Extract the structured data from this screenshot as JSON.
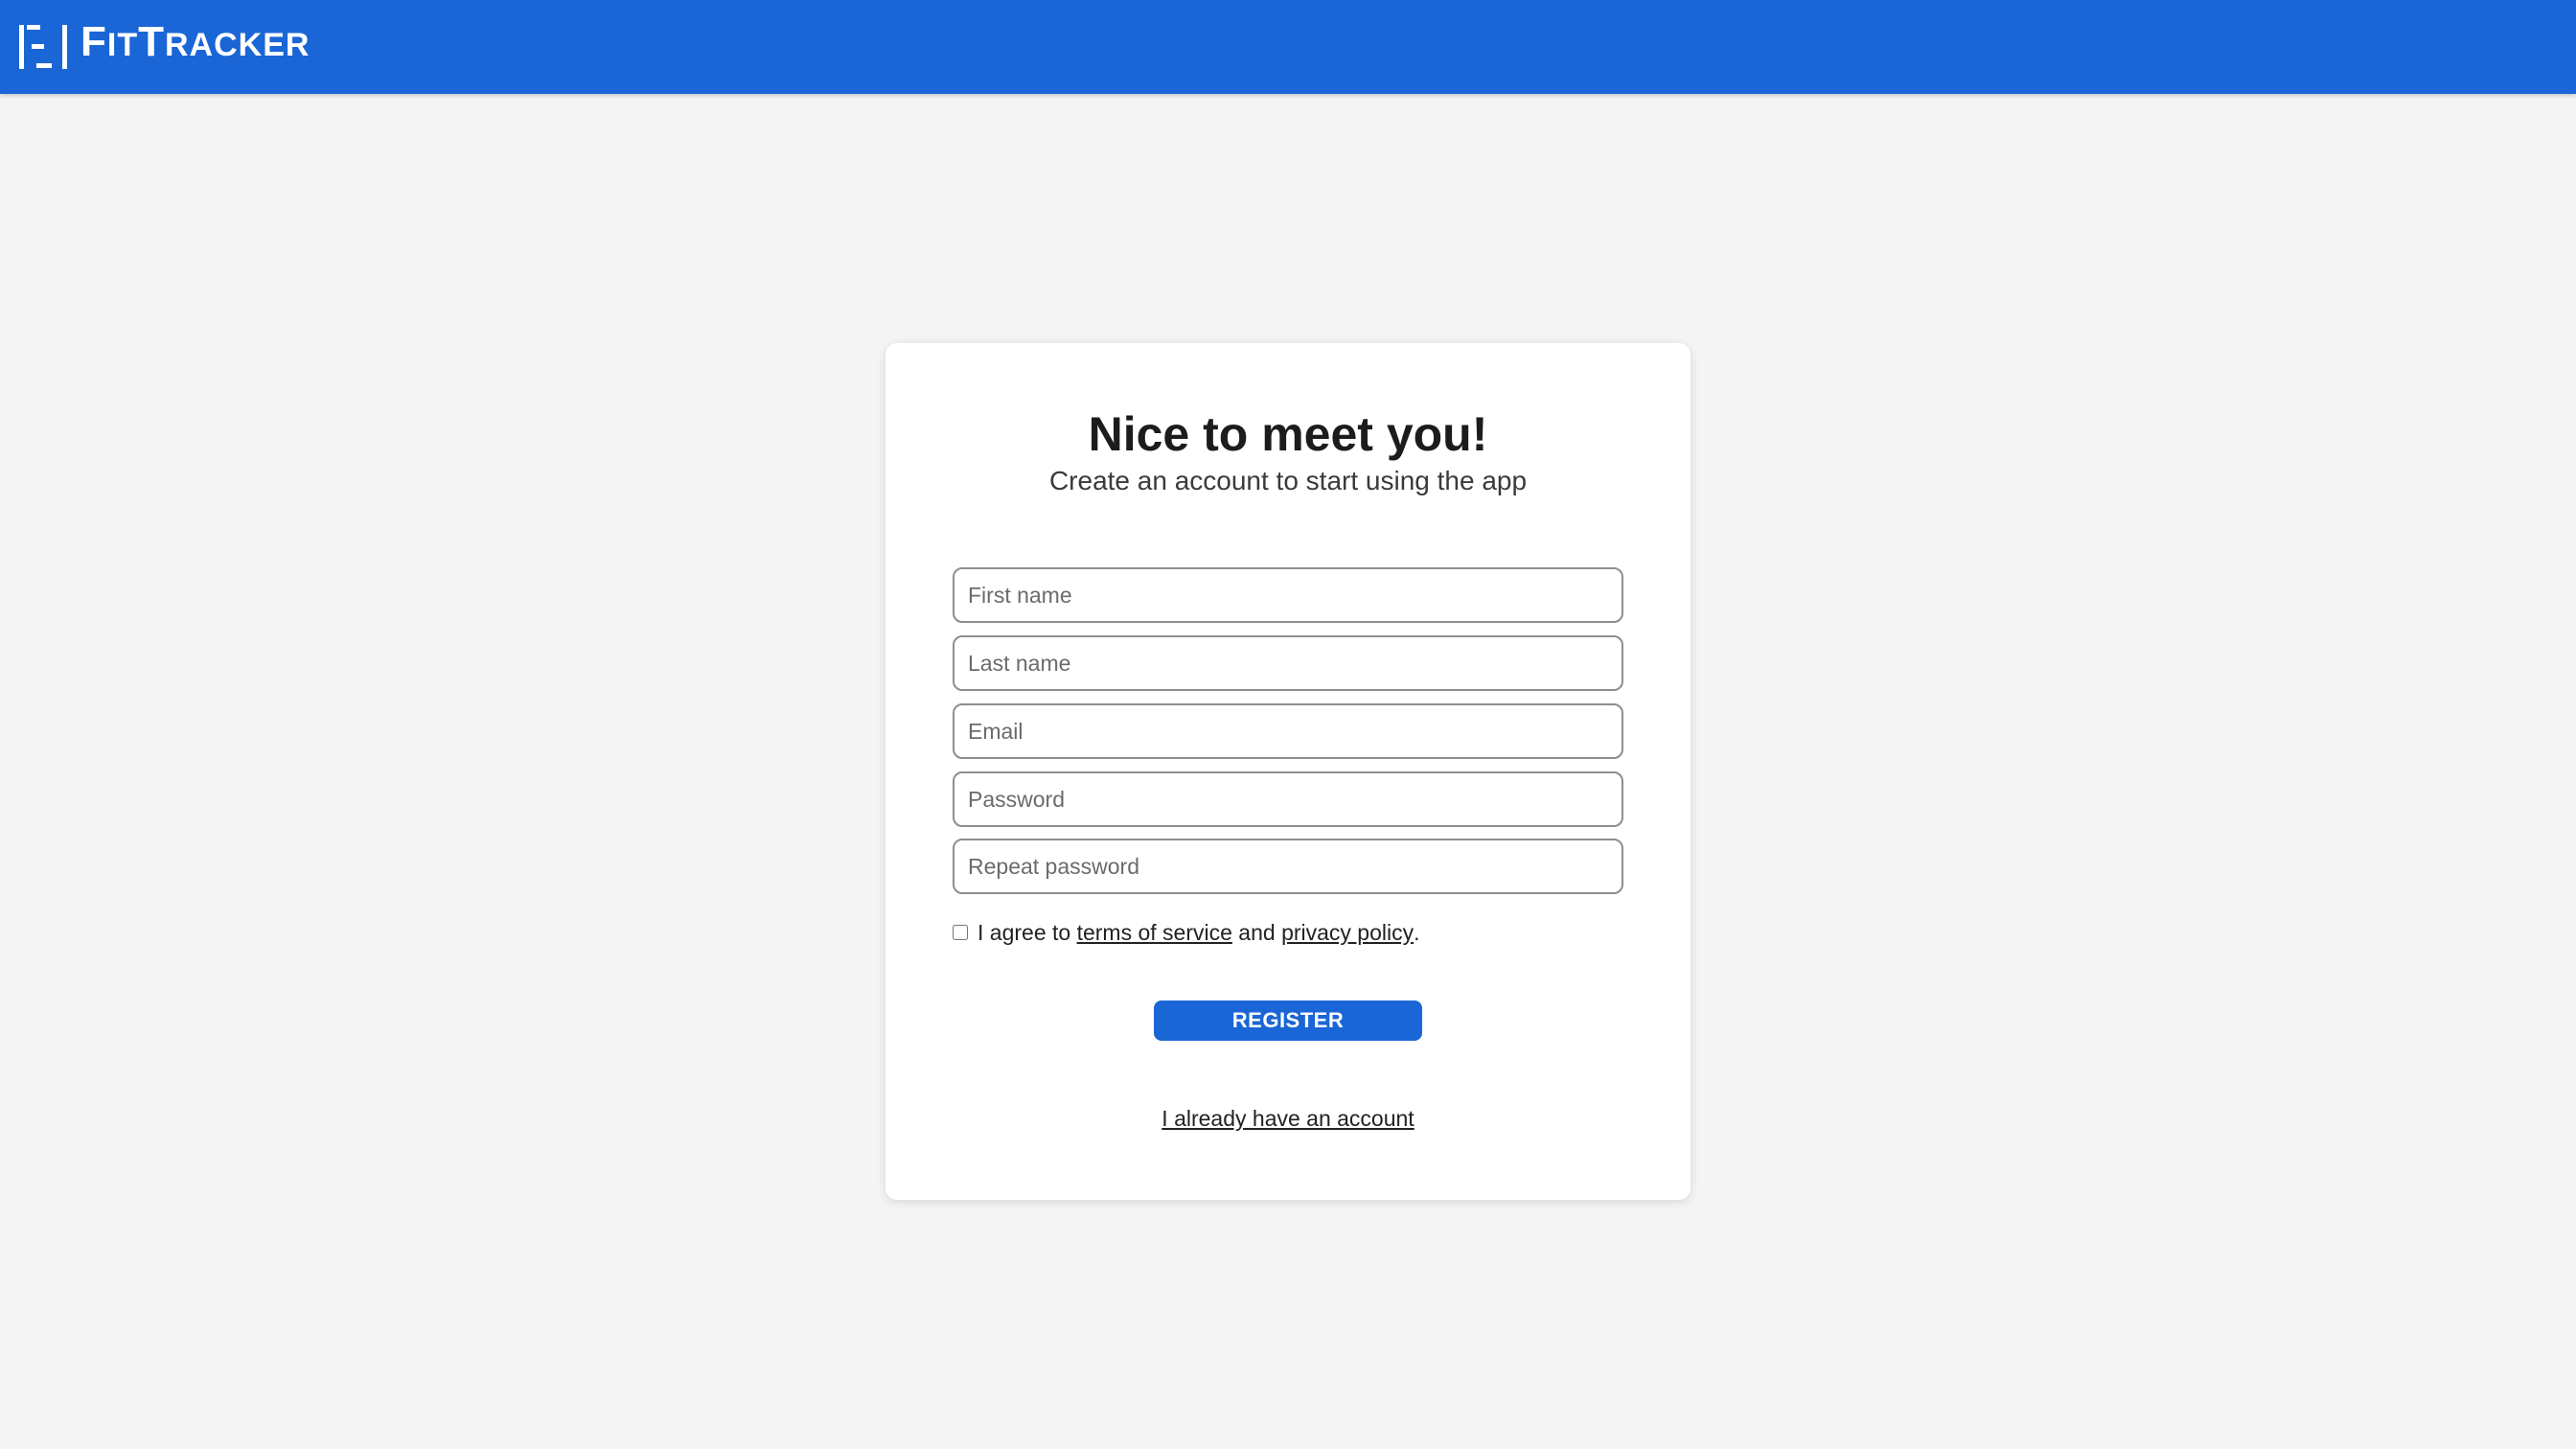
{
  "header": {
    "logo_first_big": "F",
    "logo_first_small": "IT",
    "logo_second_big": "T",
    "logo_second_small": "RACKER",
    "background_color": "#1a66d6",
    "logo_icon": "fittracker-logo-icon"
  },
  "page": {
    "background_color": "#f4f4f4"
  },
  "form": {
    "title": "Nice to meet you!",
    "subtitle": "Create an account to start using the app",
    "fields": {
      "first_name": {
        "placeholder": "First name",
        "value": ""
      },
      "last_name": {
        "placeholder": "Last name",
        "value": ""
      },
      "email": {
        "placeholder": "Email",
        "value": ""
      },
      "password": {
        "placeholder": "Password",
        "value": ""
      },
      "repeat_password": {
        "placeholder": "Repeat password",
        "value": ""
      }
    },
    "agree": {
      "checked": false,
      "prefix": "I agree to",
      "terms_link": "terms of service",
      "middle": "and",
      "privacy_link": "privacy policy",
      "suffix": "."
    },
    "register_label": "REGISTER",
    "login_link": "I already have an account",
    "accent_color": "#1a66d6"
  }
}
